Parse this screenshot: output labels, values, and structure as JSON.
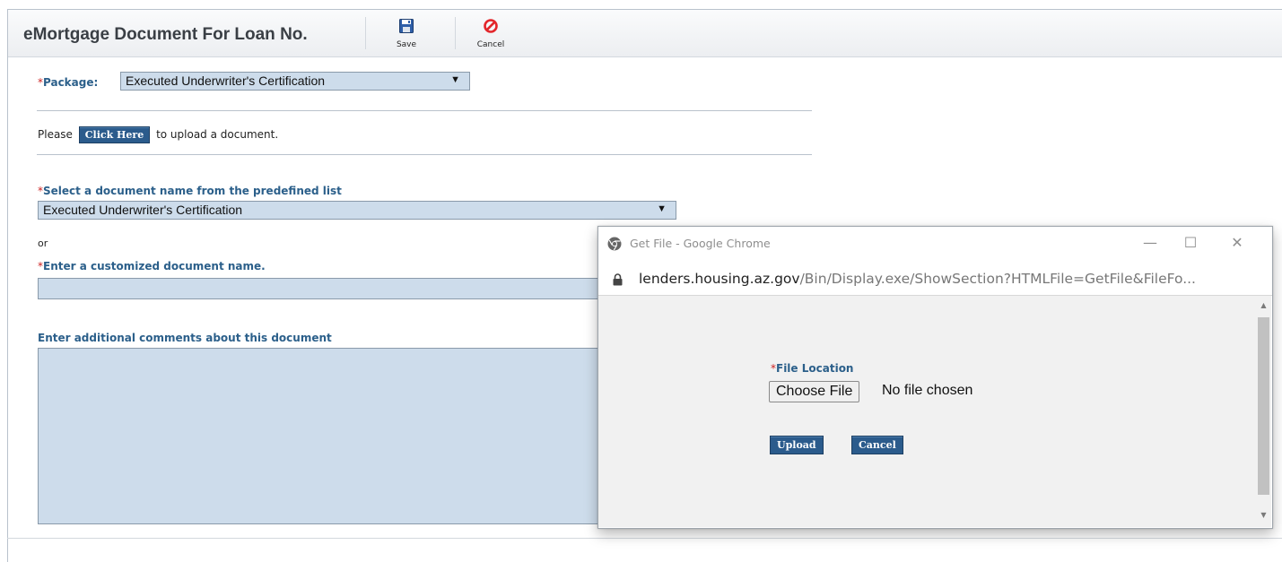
{
  "header": {
    "title": "eMortgage Document For Loan No.",
    "save_label": "Save",
    "cancel_label": "Cancel"
  },
  "package": {
    "label": "Package:",
    "required_marker": "*",
    "selected": "Executed Underwriter's Certification"
  },
  "upload_prompt": {
    "before": "Please",
    "button": "Click Here",
    "after": "to upload a document."
  },
  "doc_name_select": {
    "label": "Select a document name from the predefined list",
    "required_marker": "*",
    "selected": "Executed Underwriter's Certification"
  },
  "or_text": "or",
  "custom_name": {
    "label": "Enter a customized document name.",
    "required_marker": "*",
    "value": ""
  },
  "comments": {
    "label": "Enter additional comments about this document",
    "value": ""
  },
  "popup": {
    "window_title": "Get File - Google Chrome",
    "url_domain": "lenders.housing.az.gov",
    "url_path": "/Bin/Display.exe/ShowSection?HTMLFile=GetFile&FileFo...",
    "file_location_label": "File Location",
    "required_marker": "*",
    "choose_file_label": "Choose File",
    "no_file_text": "No file chosen",
    "upload_label": "Upload",
    "cancel_label": "Cancel",
    "controls": {
      "minimize": "—",
      "maximize": "☐",
      "close": "✕"
    }
  },
  "colors": {
    "label_blue": "#2b5f8a",
    "required_red": "#cc2222",
    "field_bg": "#cddceb",
    "button_blue": "#2b5b8c"
  }
}
